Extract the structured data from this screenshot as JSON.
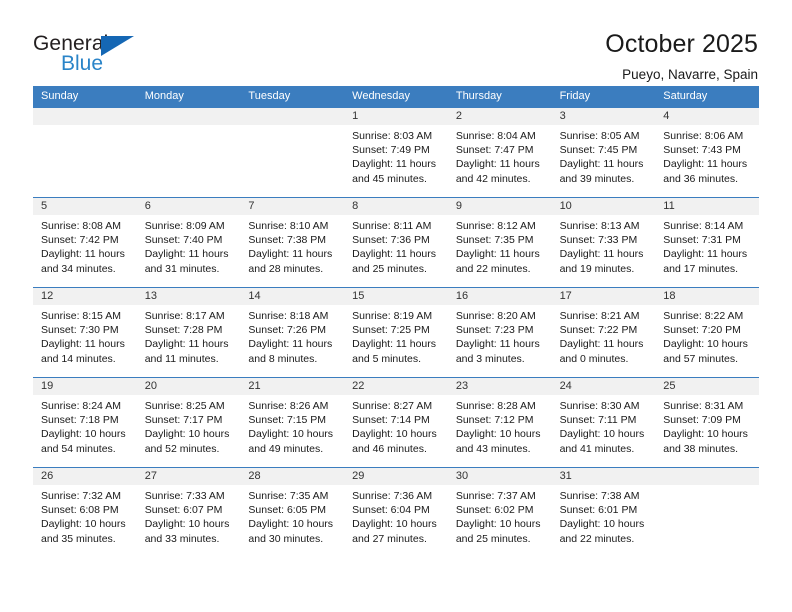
{
  "brand": {
    "name_top": "General",
    "name_bottom": "Blue",
    "accent_color": "#1567b4",
    "accent_color_light": "#2a84c8"
  },
  "header": {
    "title": "October 2025",
    "subtitle": "Pueyo, Navarre, Spain"
  },
  "calendar": {
    "header_bg": "#3b7dbf",
    "daynum_bg": "#f1f1f1",
    "weekdays": [
      "Sunday",
      "Monday",
      "Tuesday",
      "Wednesday",
      "Thursday",
      "Friday",
      "Saturday"
    ],
    "labels": {
      "sunrise": "Sunrise:",
      "sunset": "Sunset:",
      "daylight": "Daylight:"
    },
    "weeks": [
      [
        {
          "day": "",
          "sunrise": "",
          "sunset": "",
          "daylight_1": "",
          "daylight_2": ""
        },
        {
          "day": "",
          "sunrise": "",
          "sunset": "",
          "daylight_1": "",
          "daylight_2": ""
        },
        {
          "day": "",
          "sunrise": "",
          "sunset": "",
          "daylight_1": "",
          "daylight_2": ""
        },
        {
          "day": "1",
          "sunrise": "Sunrise: 8:03 AM",
          "sunset": "Sunset: 7:49 PM",
          "daylight_1": "Daylight: 11 hours",
          "daylight_2": "and 45 minutes."
        },
        {
          "day": "2",
          "sunrise": "Sunrise: 8:04 AM",
          "sunset": "Sunset: 7:47 PM",
          "daylight_1": "Daylight: 11 hours",
          "daylight_2": "and 42 minutes."
        },
        {
          "day": "3",
          "sunrise": "Sunrise: 8:05 AM",
          "sunset": "Sunset: 7:45 PM",
          "daylight_1": "Daylight: 11 hours",
          "daylight_2": "and 39 minutes."
        },
        {
          "day": "4",
          "sunrise": "Sunrise: 8:06 AM",
          "sunset": "Sunset: 7:43 PM",
          "daylight_1": "Daylight: 11 hours",
          "daylight_2": "and 36 minutes."
        }
      ],
      [
        {
          "day": "5",
          "sunrise": "Sunrise: 8:08 AM",
          "sunset": "Sunset: 7:42 PM",
          "daylight_1": "Daylight: 11 hours",
          "daylight_2": "and 34 minutes."
        },
        {
          "day": "6",
          "sunrise": "Sunrise: 8:09 AM",
          "sunset": "Sunset: 7:40 PM",
          "daylight_1": "Daylight: 11 hours",
          "daylight_2": "and 31 minutes."
        },
        {
          "day": "7",
          "sunrise": "Sunrise: 8:10 AM",
          "sunset": "Sunset: 7:38 PM",
          "daylight_1": "Daylight: 11 hours",
          "daylight_2": "and 28 minutes."
        },
        {
          "day": "8",
          "sunrise": "Sunrise: 8:11 AM",
          "sunset": "Sunset: 7:36 PM",
          "daylight_1": "Daylight: 11 hours",
          "daylight_2": "and 25 minutes."
        },
        {
          "day": "9",
          "sunrise": "Sunrise: 8:12 AM",
          "sunset": "Sunset: 7:35 PM",
          "daylight_1": "Daylight: 11 hours",
          "daylight_2": "and 22 minutes."
        },
        {
          "day": "10",
          "sunrise": "Sunrise: 8:13 AM",
          "sunset": "Sunset: 7:33 PM",
          "daylight_1": "Daylight: 11 hours",
          "daylight_2": "and 19 minutes."
        },
        {
          "day": "11",
          "sunrise": "Sunrise: 8:14 AM",
          "sunset": "Sunset: 7:31 PM",
          "daylight_1": "Daylight: 11 hours",
          "daylight_2": "and 17 minutes."
        }
      ],
      [
        {
          "day": "12",
          "sunrise": "Sunrise: 8:15 AM",
          "sunset": "Sunset: 7:30 PM",
          "daylight_1": "Daylight: 11 hours",
          "daylight_2": "and 14 minutes."
        },
        {
          "day": "13",
          "sunrise": "Sunrise: 8:17 AM",
          "sunset": "Sunset: 7:28 PM",
          "daylight_1": "Daylight: 11 hours",
          "daylight_2": "and 11 minutes."
        },
        {
          "day": "14",
          "sunrise": "Sunrise: 8:18 AM",
          "sunset": "Sunset: 7:26 PM",
          "daylight_1": "Daylight: 11 hours",
          "daylight_2": "and 8 minutes."
        },
        {
          "day": "15",
          "sunrise": "Sunrise: 8:19 AM",
          "sunset": "Sunset: 7:25 PM",
          "daylight_1": "Daylight: 11 hours",
          "daylight_2": "and 5 minutes."
        },
        {
          "day": "16",
          "sunrise": "Sunrise: 8:20 AM",
          "sunset": "Sunset: 7:23 PM",
          "daylight_1": "Daylight: 11 hours",
          "daylight_2": "and 3 minutes."
        },
        {
          "day": "17",
          "sunrise": "Sunrise: 8:21 AM",
          "sunset": "Sunset: 7:22 PM",
          "daylight_1": "Daylight: 11 hours",
          "daylight_2": "and 0 minutes."
        },
        {
          "day": "18",
          "sunrise": "Sunrise: 8:22 AM",
          "sunset": "Sunset: 7:20 PM",
          "daylight_1": "Daylight: 10 hours",
          "daylight_2": "and 57 minutes."
        }
      ],
      [
        {
          "day": "19",
          "sunrise": "Sunrise: 8:24 AM",
          "sunset": "Sunset: 7:18 PM",
          "daylight_1": "Daylight: 10 hours",
          "daylight_2": "and 54 minutes."
        },
        {
          "day": "20",
          "sunrise": "Sunrise: 8:25 AM",
          "sunset": "Sunset: 7:17 PM",
          "daylight_1": "Daylight: 10 hours",
          "daylight_2": "and 52 minutes."
        },
        {
          "day": "21",
          "sunrise": "Sunrise: 8:26 AM",
          "sunset": "Sunset: 7:15 PM",
          "daylight_1": "Daylight: 10 hours",
          "daylight_2": "and 49 minutes."
        },
        {
          "day": "22",
          "sunrise": "Sunrise: 8:27 AM",
          "sunset": "Sunset: 7:14 PM",
          "daylight_1": "Daylight: 10 hours",
          "daylight_2": "and 46 minutes."
        },
        {
          "day": "23",
          "sunrise": "Sunrise: 8:28 AM",
          "sunset": "Sunset: 7:12 PM",
          "daylight_1": "Daylight: 10 hours",
          "daylight_2": "and 43 minutes."
        },
        {
          "day": "24",
          "sunrise": "Sunrise: 8:30 AM",
          "sunset": "Sunset: 7:11 PM",
          "daylight_1": "Daylight: 10 hours",
          "daylight_2": "and 41 minutes."
        },
        {
          "day": "25",
          "sunrise": "Sunrise: 8:31 AM",
          "sunset": "Sunset: 7:09 PM",
          "daylight_1": "Daylight: 10 hours",
          "daylight_2": "and 38 minutes."
        }
      ],
      [
        {
          "day": "26",
          "sunrise": "Sunrise: 7:32 AM",
          "sunset": "Sunset: 6:08 PM",
          "daylight_1": "Daylight: 10 hours",
          "daylight_2": "and 35 minutes."
        },
        {
          "day": "27",
          "sunrise": "Sunrise: 7:33 AM",
          "sunset": "Sunset: 6:07 PM",
          "daylight_1": "Daylight: 10 hours",
          "daylight_2": "and 33 minutes."
        },
        {
          "day": "28",
          "sunrise": "Sunrise: 7:35 AM",
          "sunset": "Sunset: 6:05 PM",
          "daylight_1": "Daylight: 10 hours",
          "daylight_2": "and 30 minutes."
        },
        {
          "day": "29",
          "sunrise": "Sunrise: 7:36 AM",
          "sunset": "Sunset: 6:04 PM",
          "daylight_1": "Daylight: 10 hours",
          "daylight_2": "and 27 minutes."
        },
        {
          "day": "30",
          "sunrise": "Sunrise: 7:37 AM",
          "sunset": "Sunset: 6:02 PM",
          "daylight_1": "Daylight: 10 hours",
          "daylight_2": "and 25 minutes."
        },
        {
          "day": "31",
          "sunrise": "Sunrise: 7:38 AM",
          "sunset": "Sunset: 6:01 PM",
          "daylight_1": "Daylight: 10 hours",
          "daylight_2": "and 22 minutes."
        },
        {
          "day": "",
          "sunrise": "",
          "sunset": "",
          "daylight_1": "",
          "daylight_2": ""
        }
      ]
    ]
  }
}
